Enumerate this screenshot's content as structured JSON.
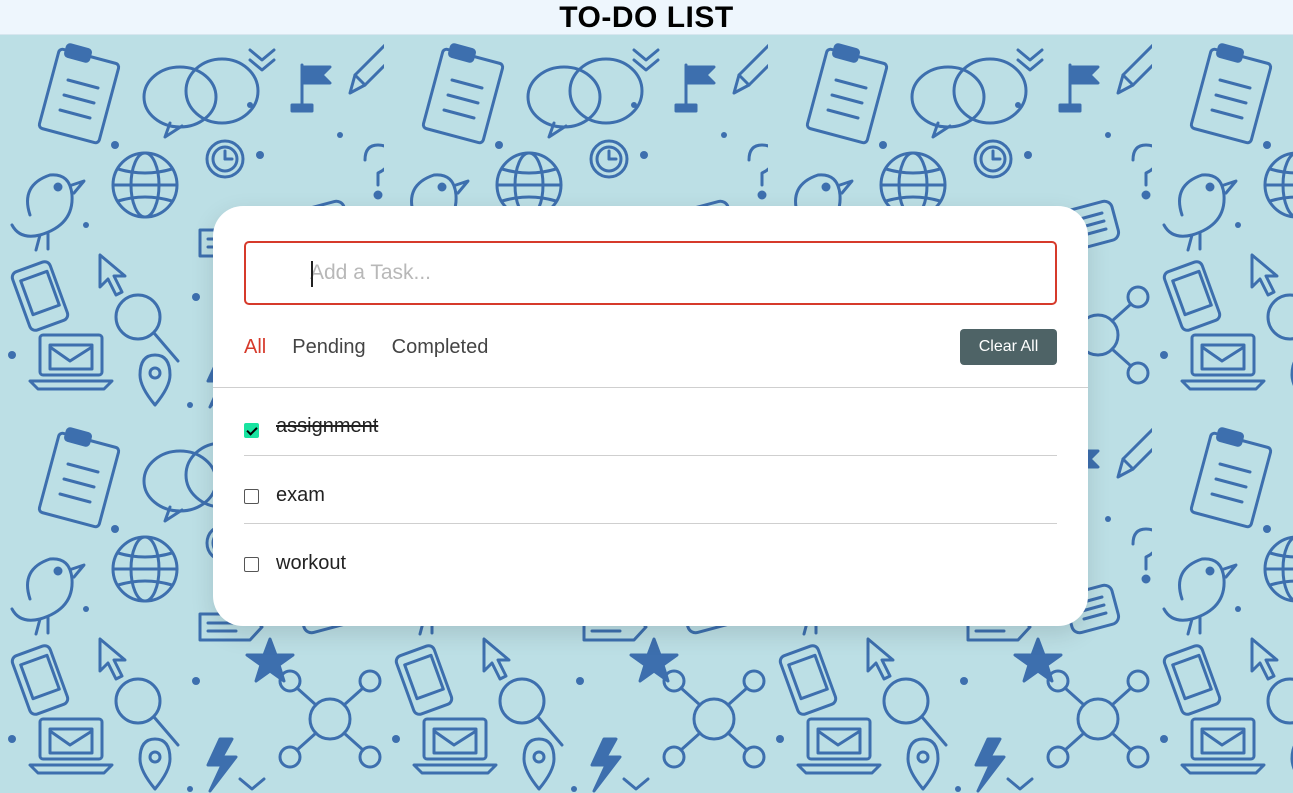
{
  "header": {
    "title": "TO-DO LIST"
  },
  "input": {
    "placeholder": "Add a Task...",
    "value": ""
  },
  "filters": [
    {
      "label": "All",
      "active": true
    },
    {
      "label": "Pending",
      "active": false
    },
    {
      "label": "Completed",
      "active": false
    }
  ],
  "clear_button": {
    "label": "Clear All"
  },
  "tasks": [
    {
      "label": "assignment",
      "completed": true
    },
    {
      "label": "exam",
      "completed": false
    },
    {
      "label": "workout",
      "completed": false
    }
  ],
  "colors": {
    "accent": "#d63a2b",
    "background": "#bcdfe5",
    "pattern": "#3d6fae",
    "check": "#19e3a0",
    "button": "#4e6366"
  },
  "icons": {
    "background_doodles": [
      "clipboard-icon",
      "speech-bubble-icon",
      "pencil-icon",
      "flag-icon",
      "clock-icon",
      "globe-icon",
      "bird-icon",
      "question-mark-icon",
      "network-icon",
      "magnifier-icon",
      "location-pin-icon",
      "star-icon",
      "lightning-icon",
      "laptop-icon",
      "phone-icon",
      "tag-icon",
      "cursor-icon"
    ]
  }
}
